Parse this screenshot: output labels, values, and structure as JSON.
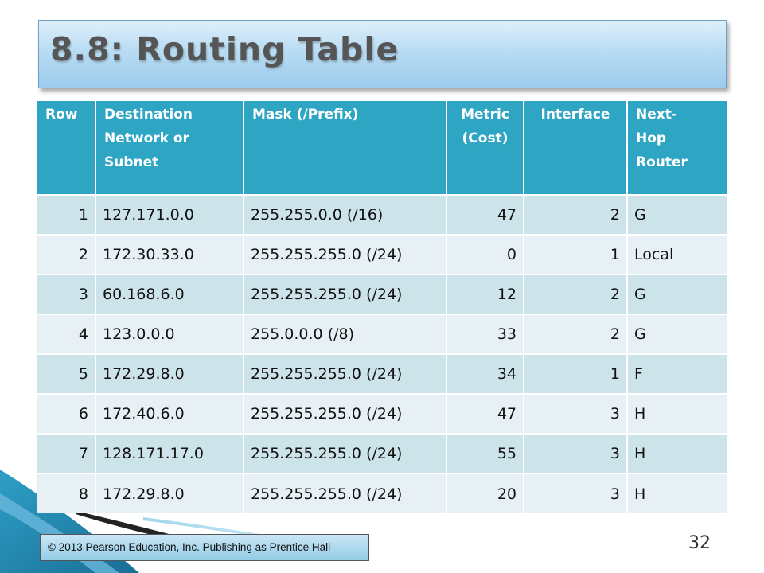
{
  "slide": {
    "title": "8.8: Routing Table",
    "page_number": "32",
    "copyright": "© 2013 Pearson Education, Inc.  Publishing as Prentice Hall"
  },
  "table": {
    "headers": {
      "row": "Row",
      "destination_line1": "Destination",
      "destination_line2": "Network or",
      "destination_line3": "Subnet",
      "mask": "Mask (/Prefix)",
      "metric_line1": "Metric",
      "metric_line2": "(Cost)",
      "interface": "Interface",
      "nexthop_line1": "Next-",
      "nexthop_line2": "Hop",
      "nexthop_line3": "Router"
    },
    "rows": [
      {
        "row": "1",
        "destination": "127.171.0.0",
        "mask": "255.255.0.0  (/16)",
        "metric": "47",
        "interface": "2",
        "next_hop": "G"
      },
      {
        "row": "2",
        "destination": "172.30.33.0",
        "mask": "255.255.255.0 (/24)",
        "metric": "0",
        "interface": "1",
        "next_hop": "Local"
      },
      {
        "row": "3",
        "destination": "60.168.6.0",
        "mask": "255.255.255.0 (/24)",
        "metric": "12",
        "interface": "2",
        "next_hop": "G"
      },
      {
        "row": "4",
        "destination": "123.0.0.0",
        "mask": "255.0.0.0 (/8)",
        "metric": "33",
        "interface": "2",
        "next_hop": "G"
      },
      {
        "row": "5",
        "destination": "172.29.8.0",
        "mask": "255.255.255.0 (/24)",
        "metric": "34",
        "interface": "1",
        "next_hop": "F"
      },
      {
        "row": "6",
        "destination": "172.40.6.0",
        "mask": "255.255.255.0 (/24)",
        "metric": "47",
        "interface": "3",
        "next_hop": "H"
      },
      {
        "row": "7",
        "destination": "128.171.17.0",
        "mask": "255.255.255.0 (/24)",
        "metric": "55",
        "interface": "3",
        "next_hop": "H"
      },
      {
        "row": "8",
        "destination": "172.29.8.0",
        "mask": "255.255.255.0 (/24)",
        "metric": "20",
        "interface": "3",
        "next_hop": "H"
      }
    ]
  },
  "colors": {
    "header_bg": "#2fa5c4",
    "row_odd_bg": "#cde3ea",
    "row_even_bg": "#e7f1f5",
    "title_gradient_top": "#dff0fb",
    "title_gradient_bottom": "#9ccbec"
  }
}
